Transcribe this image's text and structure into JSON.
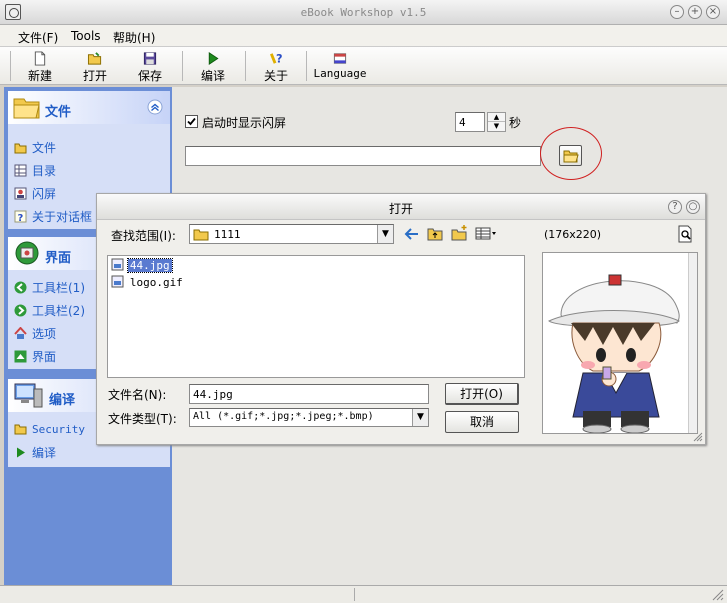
{
  "window": {
    "title": "eBook Workshop v1.5"
  },
  "menu": {
    "items": [
      "文件(F)",
      "Tools",
      "帮助(H)"
    ]
  },
  "toolbar": {
    "buttons": [
      "新建",
      "打开",
      "保存",
      "编译",
      "关于",
      "Language"
    ]
  },
  "sidebar": {
    "panels": [
      {
        "title": "文件",
        "items": [
          "文件",
          "目录",
          "闪屏",
          "关于对话框"
        ]
      },
      {
        "title": "界面",
        "items": [
          "工具栏(1)",
          "工具栏(2)",
          "选项",
          "界面"
        ]
      },
      {
        "title": "编译",
        "items": [
          "Security",
          "编译"
        ]
      }
    ]
  },
  "main": {
    "splash_checkbox_label": "启动时显示闪屏",
    "splash_checked": true,
    "seconds_value": "4",
    "seconds_unit": "秒",
    "path_value": ""
  },
  "dialog": {
    "title": "打开",
    "lookin_label": "查找范围(I):",
    "lookin_value": "1111",
    "files": [
      "44.jpg",
      "logo.gif"
    ],
    "selected_file": "44.jpg",
    "filename_label": "文件名(N):",
    "filename_value": "44.jpg",
    "filetype_label": "文件类型(T):",
    "filetype_value": "All (*.gif;*.jpg;*.jpeg;*.bmp)",
    "open_button": "打开(O)",
    "cancel_button": "取消",
    "preview_size": "(176x220)"
  },
  "colors": {
    "accent": "#215dc6",
    "sidebar_bg": "#6b8ed6",
    "highlight_circle": "#d02020"
  }
}
